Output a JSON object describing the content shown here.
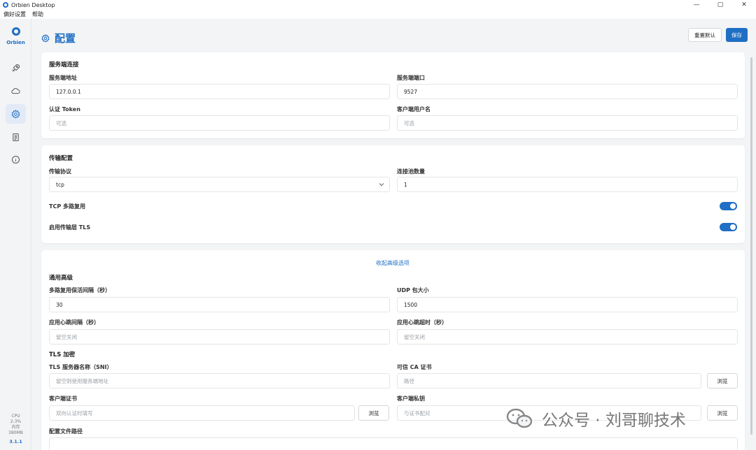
{
  "window": {
    "title": "Orbien Desktop",
    "controls": [
      "—",
      "▢",
      "✕"
    ]
  },
  "menu": {
    "prefs": "偏好设置",
    "help": "帮助"
  },
  "sidebar": {
    "logo_text": "Orbien",
    "stats": {
      "cpu_label": "CPU",
      "cpu_value": "2.3%",
      "mem_label": "内存",
      "mem_value": "380MB",
      "version": "3.1.1"
    }
  },
  "header": {
    "title": "配置",
    "reset_label": "重置默认",
    "save_label": "保存"
  },
  "server": {
    "title": "服务端连接",
    "address_label": "服务端地址",
    "address_value": "127.0.0.1",
    "port_label": "服务端端口",
    "port_value": "9527",
    "token_label": "认证 Token",
    "token_placeholder": "可选",
    "username_label": "客户端用户名",
    "username_placeholder": "可选"
  },
  "transport": {
    "title": "传输配置",
    "protocol_label": "传输协议",
    "protocol_value": "tcp",
    "pool_label": "连接池数量",
    "pool_value": "1",
    "mux_label": "TCP 多路复用",
    "mux_on": true,
    "tls_label": "启用传输层 TLS",
    "tls_on": true
  },
  "advanced": {
    "collapse_label": "收起高级选项",
    "general_title": "通用高级",
    "keepalive_label": "多路复用保活间隔（秒）",
    "keepalive_value": "30",
    "udp_label": "UDP 包大小",
    "udp_value": "1500",
    "hb_interval_label": "应用心跳间隔（秒）",
    "hb_interval_placeholder": "留空关闭",
    "hb_timeout_label": "应用心跳超时（秒）",
    "hb_timeout_placeholder": "留空关闭",
    "tls_title": "TLS 加密",
    "sni_label": "TLS 服务器名称（SNI）",
    "sni_placeholder": "留空则使用服务端地址",
    "ca_label": "可信 CA 证书",
    "ca_placeholder": "路径",
    "client_cert_label": "客户端证书",
    "client_cert_placeholder": "双向认证时填写",
    "client_key_label": "客户端私钥",
    "client_key_placeholder": "与证书配对",
    "browse_label": "浏览",
    "config_path_label": "配置文件路径"
  },
  "watermark": "公众号 · 刘哥聊技术",
  "colors": {
    "accent": "#1f6fc4",
    "background": "#f3f4f6"
  }
}
